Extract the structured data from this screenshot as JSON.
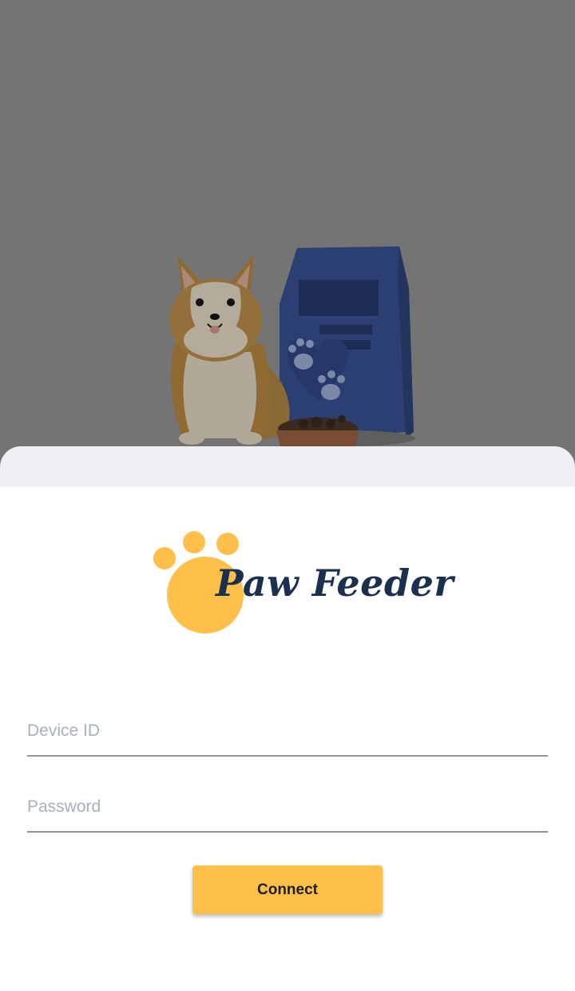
{
  "brand": {
    "name": "Paw Feeder",
    "accent_color": "#fec04b",
    "text_color": "#1b2f4f"
  },
  "hero": {
    "illustration": "corgi-with-food-bag-and-bowl"
  },
  "form": {
    "device_id": {
      "value": "",
      "placeholder": "Device ID"
    },
    "password": {
      "value": "",
      "placeholder": "Password"
    },
    "connect_label": "Connect"
  }
}
